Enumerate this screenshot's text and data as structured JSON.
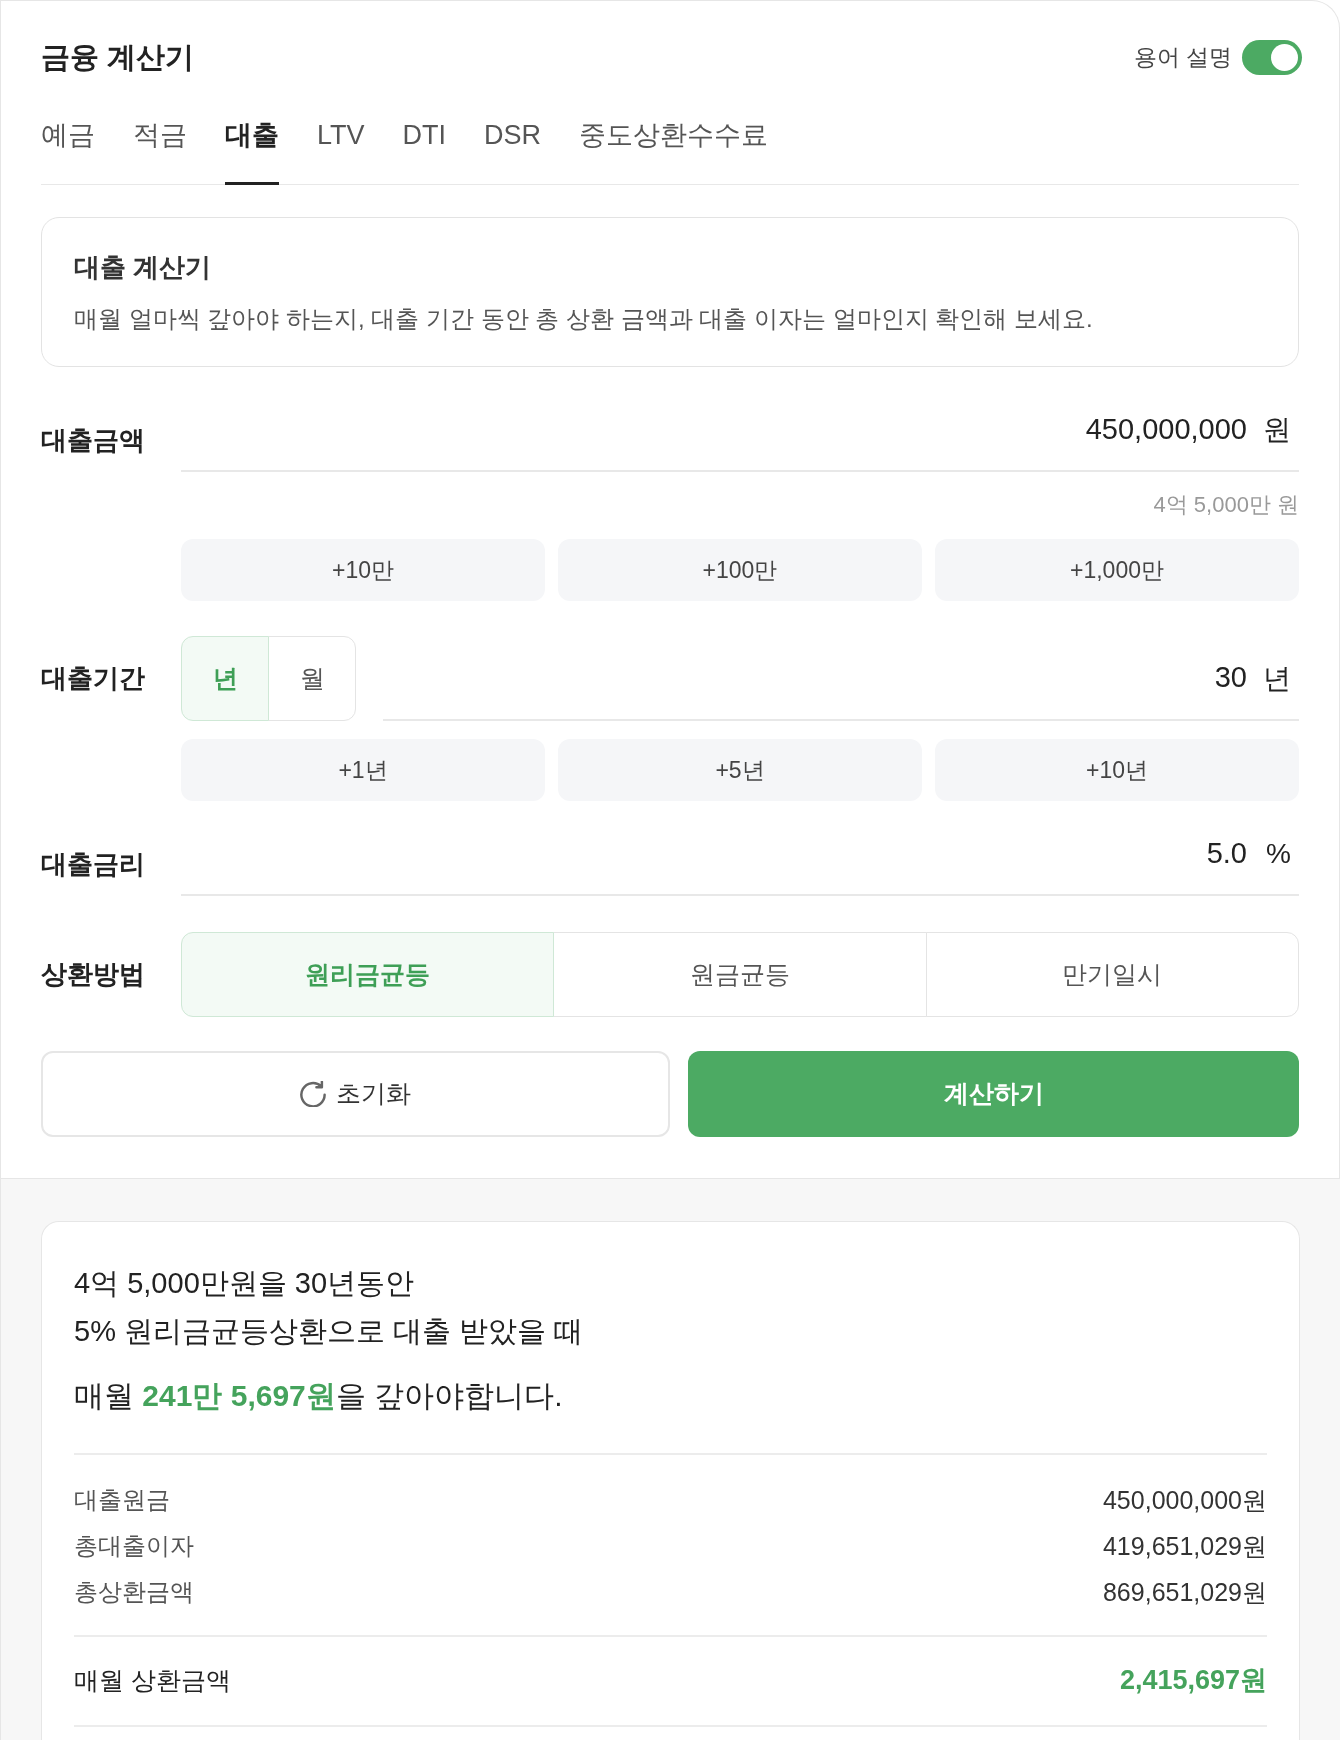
{
  "header": {
    "title": "금융 계산기",
    "glossary_toggle": {
      "label": "용어 설명",
      "on": true
    }
  },
  "tabs": [
    {
      "label": "예금",
      "selected": false
    },
    {
      "label": "적금",
      "selected": false
    },
    {
      "label": "대출",
      "selected": true
    },
    {
      "label": "LTV",
      "selected": false
    },
    {
      "label": "DTI",
      "selected": false
    },
    {
      "label": "DSR",
      "selected": false
    },
    {
      "label": "중도상환수수료",
      "selected": false
    }
  ],
  "intro": {
    "title": "대출 계산기",
    "description": "매월 얼마씩 갚아야 하는지, 대출 기간 동안 총 상환 금액과 대출 이자는 얼마인지 확인해 보세요."
  },
  "fields": [
    {
      "kind": "amount",
      "label": "대출금액",
      "value": "450,000,000",
      "unit": "원",
      "hint": "4억 5,000만 원",
      "quick_buttons": [
        "+10만",
        "+100만",
        "+1,000만"
      ]
    },
    {
      "kind": "term",
      "label": "대출기간",
      "unit_options": [
        {
          "label": "년",
          "selected": true
        },
        {
          "label": "월",
          "selected": false
        }
      ],
      "value": "30",
      "unit": "년",
      "quick_buttons": [
        "+1년",
        "+5년",
        "+10년"
      ]
    },
    {
      "kind": "rate",
      "label": "대출금리",
      "value": "5.0",
      "unit": "%"
    },
    {
      "kind": "method",
      "label": "상환방법",
      "options": [
        {
          "label": "원리금균등",
          "selected": true
        },
        {
          "label": "원금균등",
          "selected": false
        },
        {
          "label": "만기일시",
          "selected": false
        }
      ]
    }
  ],
  "actions": {
    "reset": "초기화",
    "calculate": "계산하기"
  },
  "result": {
    "summary_lines": [
      "4억 5,000만원을 30년동안",
      "5% 원리금균등상환으로 대출 받았을 때"
    ],
    "headline": "매월 **241만 5,697원**을 갚아야합니다.",
    "rows": [
      {
        "label": "대출원금",
        "value": "450,000,000원"
      },
      {
        "label": "총대출이자",
        "value": "419,651,029원"
      },
      {
        "label": "총상환금액",
        "value": "869,651,029원"
      }
    ],
    "total": {
      "label": "매월 상환금액",
      "value": "2,415,697원"
    }
  }
}
